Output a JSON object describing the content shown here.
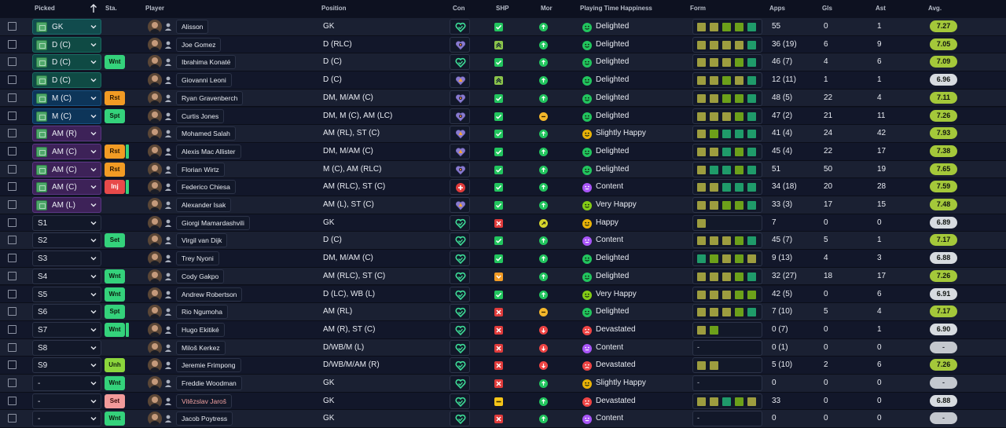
{
  "columns": {
    "picked": "Picked",
    "sta": "Sta.",
    "player": "Player",
    "position": "Position",
    "con": "Con",
    "shp": "SHP",
    "mor": "Mor",
    "happiness": "Playing Time Happiness",
    "form": "Form",
    "apps": "Apps",
    "gls": "Gls",
    "ast": "Ast",
    "avg": "Avg."
  },
  "colors": {
    "form_green": "#1f9b6a",
    "form_olive": "#9d9d3f",
    "form_dark_olive": "#5f8a18",
    "form_lime": "#6ca01a",
    "avg_good": "#a4c83a",
    "shp_green": "#22c55e",
    "shp_red": "#e03b3b",
    "con_heart": "#3ddc97"
  },
  "players": [
    {
      "picked": "GK",
      "pick_style": "gk",
      "pitch_icon": true,
      "status": "",
      "status_style": "",
      "status_bar": false,
      "name": "Alisson",
      "loan": false,
      "position": "GK",
      "con": "heart-icon",
      "shp": "check",
      "mor": "up",
      "hap_icon": "happy-face-icon",
      "hap_color": "#22c55e",
      "happiness": "Delighted",
      "form": [
        "olive",
        "olive",
        "lime",
        "lime",
        "green"
      ],
      "form_empty": false,
      "apps": "55",
      "gls": "0",
      "ast": "1",
      "avg": "7.27",
      "avg_style": "good"
    },
    {
      "picked": "D (C)",
      "pick_style": "d",
      "pitch_icon": true,
      "status": "",
      "status_style": "",
      "status_bar": false,
      "name": "Joe Gomez",
      "loan": false,
      "position": "D (RLC)",
      "con": "heart-dot-icon",
      "shp": "double-up",
      "mor": "up",
      "hap_icon": "happy-face-icon",
      "hap_color": "#22c55e",
      "happiness": "Delighted",
      "form": [
        "olive",
        "olive",
        "olive",
        "olive",
        "green"
      ],
      "form_empty": false,
      "apps": "36 (19)",
      "gls": "6",
      "ast": "9",
      "avg": "7.05",
      "avg_style": "good"
    },
    {
      "picked": "D (C)",
      "pick_style": "d",
      "pitch_icon": true,
      "status": "Wnt",
      "status_style": "green",
      "status_bar": false,
      "name": "Ibrahima Konaté",
      "loan": false,
      "position": "D (C)",
      "con": "heart-icon",
      "shp": "check",
      "mor": "up",
      "hap_icon": "happy-face-icon",
      "hap_color": "#22c55e",
      "happiness": "Delighted",
      "form": [
        "olive",
        "olive",
        "olive",
        "lime",
        "green"
      ],
      "form_empty": false,
      "apps": "46 (7)",
      "gls": "4",
      "ast": "6",
      "avg": "7.09",
      "avg_style": "good"
    },
    {
      "picked": "D (C)",
      "pick_style": "d",
      "pitch_icon": true,
      "status": "",
      "status_style": "",
      "status_bar": false,
      "name": "Giovanni Leoni",
      "loan": false,
      "position": "D (C)",
      "con": "heart-warn-icon",
      "shp": "double-up",
      "mor": "up",
      "hap_icon": "happy-face-icon",
      "hap_color": "#22c55e",
      "happiness": "Delighted",
      "form": [
        "olive",
        "olive",
        "lime",
        "olive",
        "green"
      ],
      "form_empty": false,
      "apps": "12 (11)",
      "gls": "1",
      "ast": "1",
      "avg": "6.96",
      "avg_style": "ok"
    },
    {
      "picked": "M (C)",
      "pick_style": "m",
      "pitch_icon": true,
      "status": "Rst",
      "status_style": "orange",
      "status_bar": false,
      "name": "Ryan Gravenberch",
      "loan": false,
      "position": "DM, M/AM (C)",
      "con": "heart-dot-icon",
      "shp": "check",
      "mor": "up",
      "hap_icon": "happy-face-icon",
      "hap_color": "#22c55e",
      "happiness": "Delighted",
      "form": [
        "olive",
        "olive",
        "lime",
        "lime",
        "green"
      ],
      "form_empty": false,
      "apps": "48 (5)",
      "gls": "22",
      "ast": "4",
      "avg": "7.11",
      "avg_style": "good"
    },
    {
      "picked": "M (C)",
      "pick_style": "m",
      "pitch_icon": true,
      "status": "Spt",
      "status_style": "green",
      "status_bar": false,
      "name": "Curtis Jones",
      "loan": false,
      "position": "DM, M (C), AM (LC)",
      "con": "heart-dot-icon",
      "shp": "check",
      "mor": "neutral",
      "hap_icon": "happy-face-icon",
      "hap_color": "#22c55e",
      "happiness": "Delighted",
      "form": [
        "olive",
        "olive",
        "olive",
        "lime",
        "green"
      ],
      "form_empty": false,
      "apps": "47 (2)",
      "gls": "21",
      "ast": "11",
      "avg": "7.26",
      "avg_style": "good"
    },
    {
      "picked": "AM (R)",
      "pick_style": "am",
      "pitch_icon": true,
      "status": "",
      "status_style": "",
      "status_bar": false,
      "name": "Mohamed Salah",
      "loan": false,
      "position": "AM (RL), ST (C)",
      "con": "heart-warn-icon",
      "shp": "check",
      "mor": "up",
      "hap_icon": "happy-face-icon",
      "hap_color": "#eab308",
      "happiness": "Slightly Happy",
      "form": [
        "olive",
        "lime",
        "green",
        "green",
        "green"
      ],
      "form_empty": false,
      "apps": "41 (4)",
      "gls": "24",
      "ast": "42",
      "avg": "7.93",
      "avg_style": "good"
    },
    {
      "picked": "AM (C)",
      "pick_style": "am",
      "pitch_icon": true,
      "status": "Rst",
      "status_style": "orange",
      "status_bar": true,
      "name": "Alexis Mac Allister",
      "loan": false,
      "position": "DM, M/AM (C)",
      "con": "heart-warn-icon",
      "shp": "check",
      "mor": "up",
      "hap_icon": "happy-face-icon",
      "hap_color": "#22c55e",
      "happiness": "Delighted",
      "form": [
        "olive",
        "olive",
        "green",
        "lime",
        "green"
      ],
      "form_empty": false,
      "apps": "45 (4)",
      "gls": "22",
      "ast": "17",
      "avg": "7.38",
      "avg_style": "good"
    },
    {
      "picked": "AM (C)",
      "pick_style": "am",
      "pitch_icon": true,
      "status": "Rst",
      "status_style": "orange",
      "status_bar": false,
      "name": "Florian Wirtz",
      "loan": false,
      "position": "M (C), AM (RLC)",
      "con": "heart-dot-icon",
      "shp": "check",
      "mor": "up",
      "hap_icon": "happy-face-icon",
      "hap_color": "#22c55e",
      "happiness": "Delighted",
      "form": [
        "olive",
        "green",
        "green",
        "lime",
        "green"
      ],
      "form_empty": false,
      "apps": "51",
      "gls": "50",
      "ast": "19",
      "avg": "7.65",
      "avg_style": "good"
    },
    {
      "picked": "AM (C)",
      "pick_style": "am",
      "pitch_icon": true,
      "status": "Inj",
      "status_style": "red",
      "status_bar": true,
      "name": "Federico Chiesa",
      "loan": false,
      "position": "AM (RLC), ST (C)",
      "con": "injury-icon",
      "shp": "check",
      "mor": "up",
      "hap_icon": "content-face-icon",
      "hap_color": "#a855f7",
      "happiness": "Content",
      "form": [
        "olive",
        "olive",
        "green",
        "green",
        "green"
      ],
      "form_empty": false,
      "apps": "34 (18)",
      "gls": "20",
      "ast": "28",
      "avg": "7.59",
      "avg_style": "good"
    },
    {
      "picked": "AM (L)",
      "pick_style": "am",
      "pitch_icon": true,
      "status": "",
      "status_style": "",
      "status_bar": false,
      "name": "Alexander Isak",
      "loan": false,
      "position": "AM (L), ST (C)",
      "con": "heart-warn-icon",
      "shp": "check",
      "mor": "up",
      "hap_icon": "happy-face-icon",
      "hap_color": "#84cc16",
      "happiness": "Very Happy",
      "form": [
        "olive",
        "olive",
        "lime",
        "lime",
        "green"
      ],
      "form_empty": false,
      "apps": "33 (3)",
      "gls": "17",
      "ast": "15",
      "avg": "7.48",
      "avg_style": "good"
    },
    {
      "picked": "S1",
      "pick_style": "plain",
      "pitch_icon": false,
      "status": "",
      "status_style": "",
      "status_bar": false,
      "name": "Giorgi Mamardashvili",
      "loan": false,
      "position": "GK",
      "con": "heart-icon",
      "shp": "cross",
      "mor": "slight-up",
      "hap_icon": "happy-face-icon",
      "hap_color": "#eab308",
      "happiness": "Happy",
      "form": [
        "olive"
      ],
      "form_empty": false,
      "apps": "7",
      "gls": "0",
      "ast": "0",
      "avg": "6.89",
      "avg_style": "ok"
    },
    {
      "picked": "S2",
      "pick_style": "plain",
      "pitch_icon": false,
      "status": "Set",
      "status_style": "green",
      "status_bar": false,
      "name": "Virgil van Dijk",
      "loan": false,
      "position": "D (C)",
      "con": "heart-icon",
      "shp": "check",
      "mor": "up",
      "hap_icon": "content-face-icon",
      "hap_color": "#a855f7",
      "happiness": "Content",
      "form": [
        "olive",
        "olive",
        "olive",
        "lime",
        "green"
      ],
      "form_empty": false,
      "apps": "45 (7)",
      "gls": "5",
      "ast": "1",
      "avg": "7.17",
      "avg_style": "good"
    },
    {
      "picked": "S3",
      "pick_style": "plain",
      "pitch_icon": false,
      "status": "",
      "status_style": "",
      "status_bar": false,
      "name": "Trey Nyoni",
      "loan": false,
      "position": "DM, M/AM (C)",
      "con": "heart-icon",
      "shp": "check",
      "mor": "up",
      "hap_icon": "happy-face-icon",
      "hap_color": "#22c55e",
      "happiness": "Delighted",
      "form": [
        "green",
        "lime",
        "olive",
        "lime",
        "olive"
      ],
      "form_empty": false,
      "apps": "9 (13)",
      "gls": "4",
      "ast": "3",
      "avg": "6.88",
      "avg_style": "ok"
    },
    {
      "picked": "S4",
      "pick_style": "plain",
      "pitch_icon": false,
      "status": "Wnt",
      "status_style": "green",
      "status_bar": false,
      "name": "Cody Gakpo",
      "loan": false,
      "position": "AM (RLC), ST (C)",
      "con": "heart-icon",
      "shp": "chevron-down",
      "mor": "up",
      "hap_icon": "happy-face-icon",
      "hap_color": "#22c55e",
      "happiness": "Delighted",
      "form": [
        "olive",
        "olive",
        "olive",
        "lime",
        "green"
      ],
      "form_empty": false,
      "apps": "32 (27)",
      "gls": "18",
      "ast": "17",
      "avg": "7.26",
      "avg_style": "good"
    },
    {
      "picked": "S5",
      "pick_style": "plain",
      "pitch_icon": false,
      "status": "Wnt",
      "status_style": "green",
      "status_bar": false,
      "name": "Andrew Robertson",
      "loan": false,
      "position": "D (LC), WB (L)",
      "con": "heart-icon",
      "shp": "check",
      "mor": "up",
      "hap_icon": "happy-face-icon",
      "hap_color": "#84cc16",
      "happiness": "Very Happy",
      "form": [
        "olive",
        "olive",
        "olive",
        "lime",
        "lime"
      ],
      "form_empty": false,
      "apps": "42 (5)",
      "gls": "0",
      "ast": "6",
      "avg": "6.91",
      "avg_style": "ok"
    },
    {
      "picked": "S6",
      "pick_style": "plain",
      "pitch_icon": false,
      "status": "Spt",
      "status_style": "green",
      "status_bar": false,
      "name": "Rio Ngumoha",
      "loan": false,
      "position": "AM (RL)",
      "con": "heart-icon",
      "shp": "cross",
      "mor": "neutral",
      "hap_icon": "happy-face-icon",
      "hap_color": "#22c55e",
      "happiness": "Delighted",
      "form": [
        "olive",
        "olive",
        "olive",
        "lime",
        "green"
      ],
      "form_empty": false,
      "apps": "7 (10)",
      "gls": "5",
      "ast": "4",
      "avg": "7.17",
      "avg_style": "good"
    },
    {
      "picked": "S7",
      "pick_style": "plain",
      "pitch_icon": false,
      "status": "Wnt",
      "status_style": "green",
      "status_bar": true,
      "name": "Hugo Ekitiké",
      "loan": false,
      "position": "AM (R), ST (C)",
      "con": "heart-icon",
      "shp": "cross",
      "mor": "down",
      "hap_icon": "sad-face-icon",
      "hap_color": "#ef4444",
      "happiness": "Devastated",
      "form": [
        "olive",
        "lime"
      ],
      "form_empty": false,
      "apps": "0 (7)",
      "gls": "0",
      "ast": "1",
      "avg": "6.90",
      "avg_style": "ok"
    },
    {
      "picked": "S8",
      "pick_style": "plain",
      "pitch_icon": false,
      "status": "",
      "status_style": "",
      "status_bar": false,
      "name": "Miloš Kerkez",
      "loan": false,
      "position": "D/WB/M (L)",
      "con": "heart-icon",
      "shp": "cross",
      "mor": "down",
      "hap_icon": "content-face-icon",
      "hap_color": "#a855f7",
      "happiness": "Content",
      "form": [],
      "form_empty": true,
      "apps": "0 (1)",
      "gls": "0",
      "ast": "0",
      "avg": "-",
      "avg_style": "none"
    },
    {
      "picked": "S9",
      "pick_style": "plain",
      "pitch_icon": false,
      "status": "Unh",
      "status_style": "lime",
      "status_bar": false,
      "name": "Jeremie Frimpong",
      "loan": false,
      "position": "D/WB/M/AM (R)",
      "con": "heart-icon",
      "shp": "cross",
      "mor": "down",
      "hap_icon": "sad-face-icon",
      "hap_color": "#ef4444",
      "happiness": "Devastated",
      "form": [
        "olive",
        "olive"
      ],
      "form_empty": false,
      "apps": "5 (10)",
      "gls": "2",
      "ast": "6",
      "avg": "7.26",
      "avg_style": "good"
    },
    {
      "picked": "-",
      "pick_style": "plain",
      "pitch_icon": false,
      "status": "Wnt",
      "status_style": "green",
      "status_bar": false,
      "name": "Freddie Woodman",
      "loan": false,
      "position": "GK",
      "con": "heart-icon",
      "shp": "cross",
      "mor": "up",
      "hap_icon": "happy-face-icon",
      "hap_color": "#eab308",
      "happiness": "Slightly Happy",
      "form": [],
      "form_empty": true,
      "apps": "0",
      "gls": "0",
      "ast": "0",
      "avg": "-",
      "avg_style": "none"
    },
    {
      "picked": "-",
      "pick_style": "plain",
      "pitch_icon": false,
      "status": "Set",
      "status_style": "pink",
      "status_bar": false,
      "name": "Vitězslav Jaroš",
      "loan": true,
      "position": "GK",
      "con": "heart-icon",
      "shp": "minus",
      "mor": "up",
      "hap_icon": "sad-face-icon",
      "hap_color": "#ef4444",
      "happiness": "Devastated",
      "form": [
        "olive",
        "olive",
        "green",
        "lime",
        "olive"
      ],
      "form_empty": false,
      "apps": "33",
      "gls": "0",
      "ast": "0",
      "avg": "6.88",
      "avg_style": "ok"
    },
    {
      "picked": "-",
      "pick_style": "plain",
      "pitch_icon": false,
      "status": "Wnt",
      "status_style": "green",
      "status_bar": false,
      "name": "Jacob Poytress",
      "loan": false,
      "position": "GK",
      "con": "heart-icon",
      "shp": "cross",
      "mor": "up",
      "hap_icon": "content-face-icon",
      "hap_color": "#a855f7",
      "happiness": "Content",
      "form": [],
      "form_empty": true,
      "apps": "0",
      "gls": "0",
      "ast": "0",
      "avg": "-",
      "avg_style": "none"
    }
  ]
}
